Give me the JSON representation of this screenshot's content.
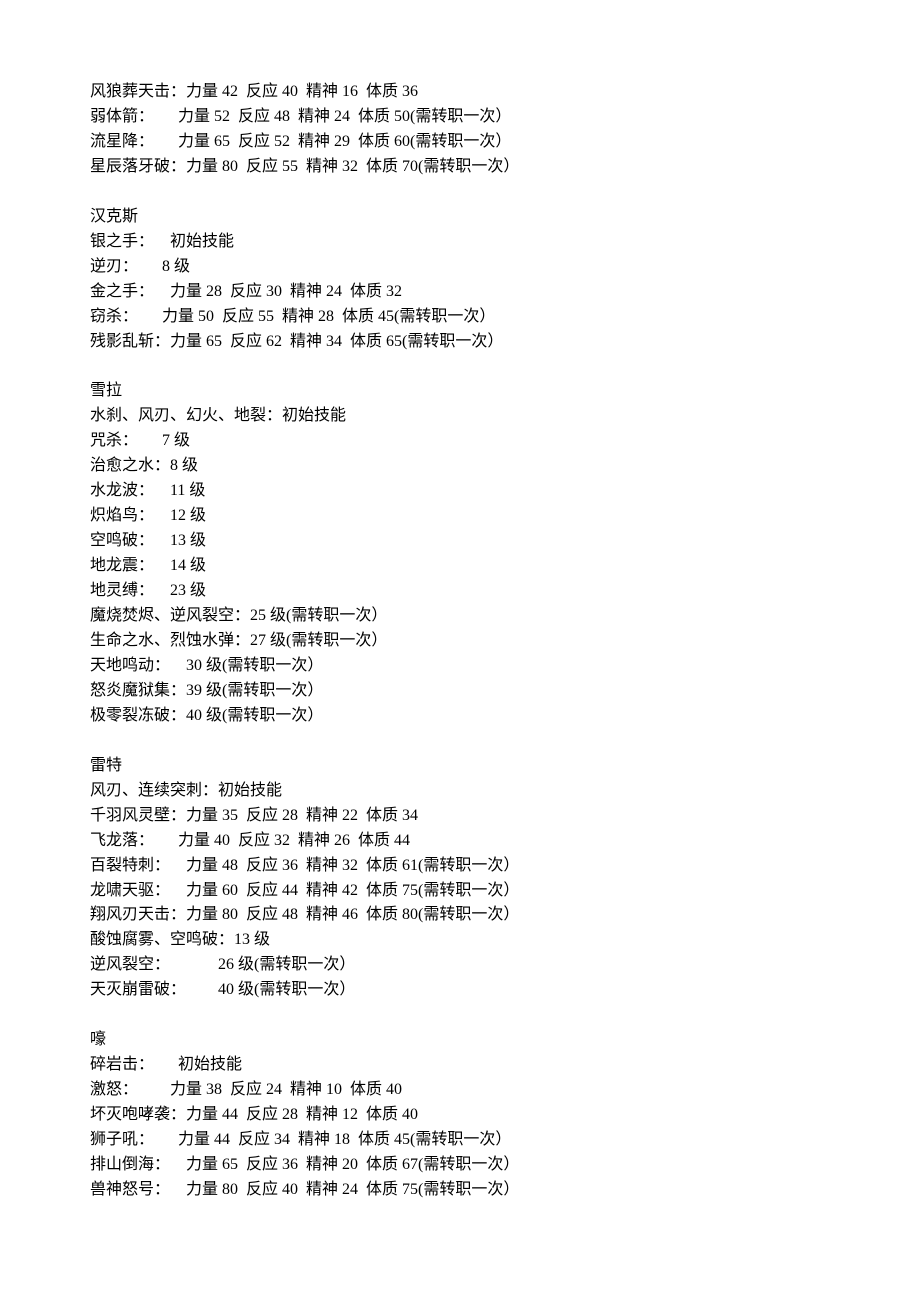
{
  "sections": [
    {
      "lines": [
        "风狼葬天击：力量 42  反应 40  精神 16  体质 36",
        "弱体箭：      力量 52  反应 48  精神 24  体质 50(需转职一次）",
        "流星降：      力量 65  反应 52  精神 29  体质 60(需转职一次）",
        "星辰落牙破：力量 80  反应 55  精神 32  体质 70(需转职一次）"
      ]
    },
    {
      "lines": [
        "汉克斯",
        "银之手：    初始技能",
        "逆刃：      8 级",
        "金之手：    力量 28  反应 30  精神 24  体质 32",
        "窃杀：      力量 50  反应 55  精神 28  体质 45(需转职一次）",
        "残影乱斩：力量 65  反应 62  精神 34  体质 65(需转职一次）"
      ]
    },
    {
      "lines": [
        "雪拉",
        "水刹、风刃、幻火、地裂：初始技能",
        "咒杀：      7 级",
        "治愈之水：8 级",
        "水龙波：    11 级",
        "炽焰鸟：    12 级",
        "空鸣破：    13 级",
        "地龙震：    14 级",
        "地灵缚：    23 级",
        "魔烧焚烬、逆风裂空：25 级(需转职一次）",
        "生命之水、烈蚀水弹：27 级(需转职一次）",
        "天地鸣动：    30 级(需转职一次）",
        "怒炎魔狱集：39 级(需转职一次）",
        "极零裂冻破：40 级(需转职一次）"
      ]
    },
    {
      "lines": [
        "雷特",
        "风刃、连续突刺：初始技能",
        "千羽风灵壁：力量 35  反应 28  精神 22  体质 34",
        "飞龙落：      力量 40  反应 32  精神 26  体质 44",
        "百裂特刺：    力量 48  反应 36  精神 32  体质 61(需转职一次）",
        "龙啸天驱：    力量 60  反应 44  精神 42  体质 75(需转职一次）",
        "翔风刃天击：力量 80  反应 48  精神 46  体质 80(需转职一次）",
        "酸蚀腐雾、空鸣破：13 级",
        "逆风裂空：            26 级(需转职一次）",
        "天灭崩雷破：        40 级(需转职一次）"
      ]
    },
    {
      "lines": [
        "嚎",
        "碎岩击：      初始技能",
        "激怒：        力量 38  反应 24  精神 10  体质 40",
        "坏灭咆哮袭：力量 44  反应 28  精神 12  体质 40",
        "狮子吼：      力量 44  反应 34  精神 18  体质 45(需转职一次）",
        "排山倒海：    力量 65  反应 36  精神 20  体质 67(需转职一次）",
        "兽神怒号：    力量 80  反应 40  精神 24  体质 75(需转职一次）"
      ]
    }
  ]
}
